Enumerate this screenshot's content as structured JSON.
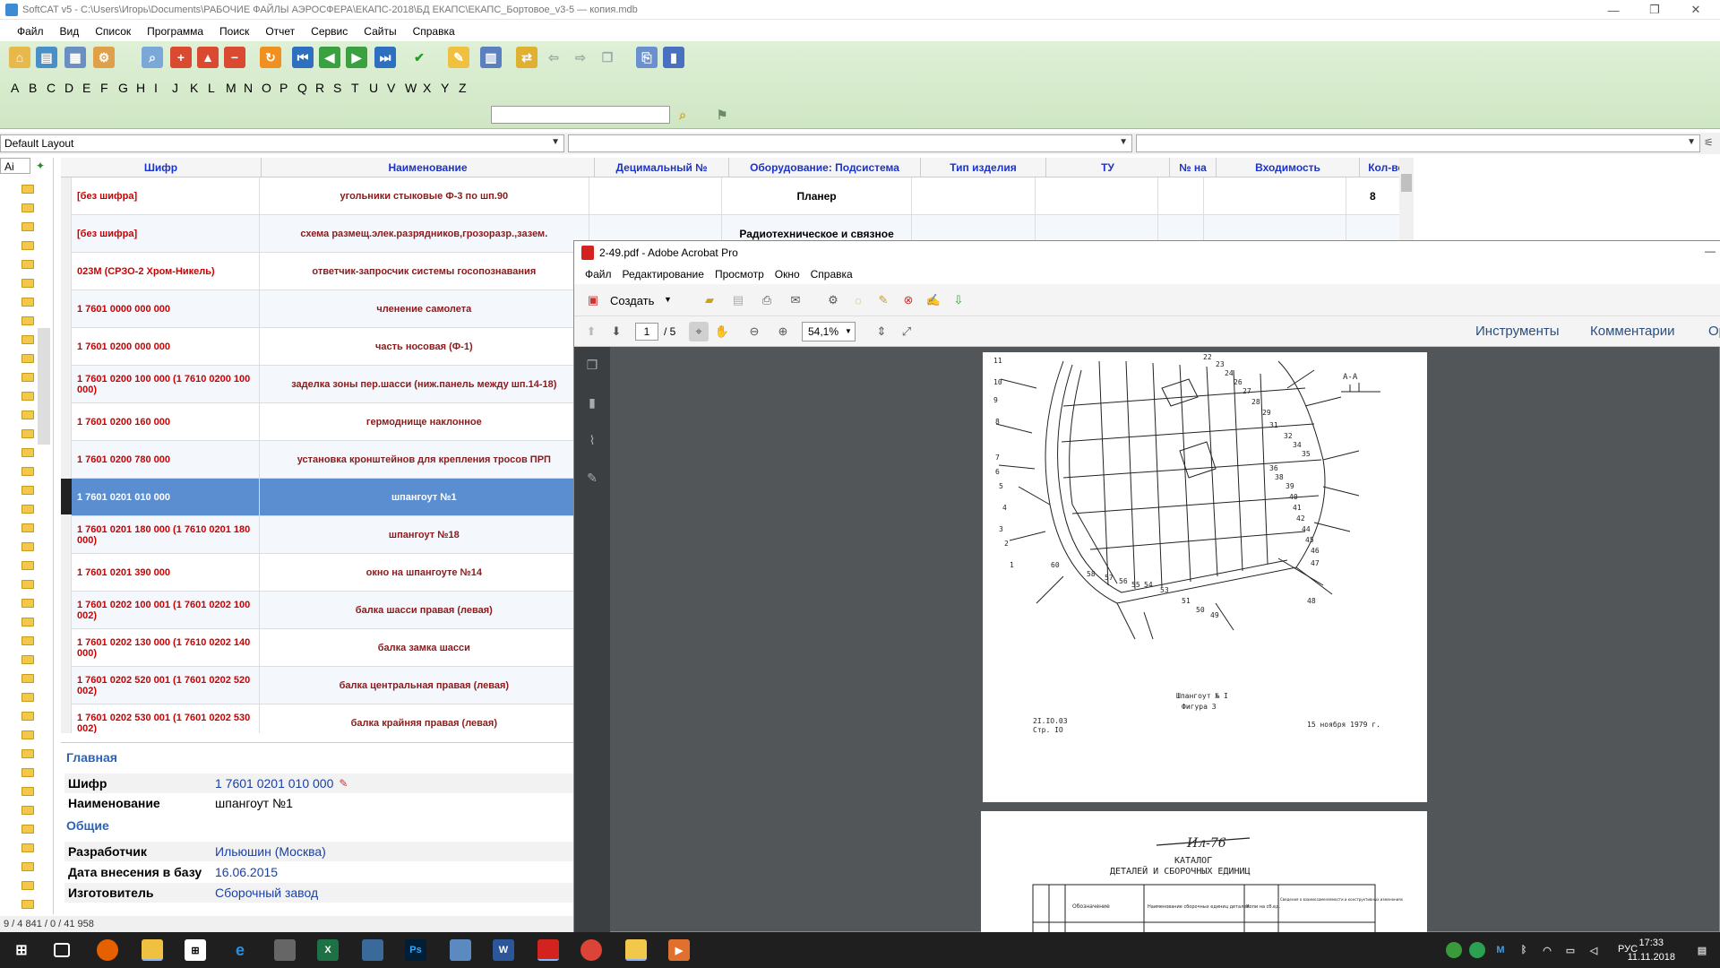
{
  "window": {
    "title": "SoftCAT v5 - C:\\Users\\Игорь\\Documents\\РАБОЧИЕ ФАЙЛЫ АЭРОСФЕРА\\ЕКАПС-2018\\БД ЕКАПС\\ЕКАПС_Бортовое_v3-5 — копия.mdb"
  },
  "menu": [
    "Файл",
    "Вид",
    "Список",
    "Программа",
    "Поиск",
    "Отчет",
    "Сервис",
    "Сайты",
    "Справка"
  ],
  "alphabet": [
    "A",
    "B",
    "C",
    "D",
    "E",
    "F",
    "G",
    "H",
    "I",
    "J",
    "K",
    "L",
    "M",
    "N",
    "O",
    "P",
    "Q",
    "R",
    "S",
    "T",
    "U",
    "V",
    "W",
    "X",
    "Y",
    "Z"
  ],
  "search": {
    "value": "",
    "placeholder": ""
  },
  "layout": {
    "selected": "Default Layout",
    "combo2": "",
    "combo3": ""
  },
  "tree_combo": "Ai",
  "grid": {
    "columns": [
      "Шифр",
      "Наименование",
      "Децимальный №",
      "Оборудование: Подсистема",
      "Тип изделия",
      "ТУ",
      "№ на",
      "Входимость",
      "Кол-во"
    ],
    "rows": [
      {
        "code": "[без шифра]",
        "name": "угольники стыковые Ф-3 по шп.90",
        "system": "Планер",
        "qty": "8"
      },
      {
        "code": "[без шифра]",
        "name": "схема размещ.элек.разрядников,грозоразр.,зазем.",
        "system": "Радиотехническое и связное",
        "qty": ""
      },
      {
        "code": "023М (СРЗО-2 Хром-Никель)",
        "name": "ответчик-запросчик системы госопознавания",
        "system": "",
        "qty": ""
      },
      {
        "code": "1 7601 0000 000 000",
        "name": "членение самолета",
        "system": "",
        "qty": ""
      },
      {
        "code": "1 7601 0200 000 000",
        "name": "часть носовая (Ф-1)",
        "system": "",
        "qty": ""
      },
      {
        "code": "1 7601 0200 100 000 (1 7610 0200 100 000)",
        "name": "заделка зоны пер.шасси (ниж.панель между шп.14-18)",
        "system": "",
        "qty": ""
      },
      {
        "code": "1 7601 0200 160 000",
        "name": "гермоднище наклонное",
        "system": "",
        "qty": ""
      },
      {
        "code": "1 7601 0200 780 000",
        "name": "установка кронштейнов для крепления тросов ПРП",
        "system": "",
        "qty": ""
      },
      {
        "code": "1 7601 0201 010 000",
        "name": "шпангоут №1",
        "system": "",
        "qty": "",
        "selected": true
      },
      {
        "code": "1 7601 0201 180 000 (1 7610 0201 180 000)",
        "name": "шпангоут №18",
        "system": "",
        "qty": ""
      },
      {
        "code": "1 7601 0201 390 000",
        "name": "окно на шпангоуте №14",
        "system": "",
        "qty": ""
      },
      {
        "code": "1 7601 0202 100 001 (1 7601 0202 100 002)",
        "name": "балка шасси правая (левая)",
        "system": "",
        "qty": ""
      },
      {
        "code": "1 7601 0202 130 000 (1 7610 0202 140 000)",
        "name": "балка замка шасси",
        "system": "",
        "qty": ""
      },
      {
        "code": "1 7601 0202 520 001 (1 7601 0202 520 002)",
        "name": "балка центральная правая (левая)",
        "system": "",
        "qty": ""
      },
      {
        "code": "1 7601 0202 530 001 (1 7601 0202 530 002)",
        "name": "балка крайняя правая (левая)",
        "system": "",
        "qty": ""
      }
    ]
  },
  "details": {
    "section_main": "Главная",
    "code_label": "Шифр",
    "code_value": "1 7601 0201 010 000",
    "name_label": "Наименование",
    "name_value": "шпангоут №1",
    "section_general": "Общие",
    "dev_label": "Разработчик",
    "dev_value": "Ильюшин (Москва)",
    "date_label": "Дата внесения в базу",
    "date_value": "16.06.2015",
    "maker_label": "Изготовитель",
    "maker_value": "Сборочный завод"
  },
  "status": "9 / 4 841 / 0 / 41 958",
  "acrobat": {
    "title": "2-49.pdf - Adobe Acrobat Pro",
    "menu": [
      "Файл",
      "Редактирование",
      "Просмотр",
      "Окно",
      "Справка"
    ],
    "create_label": "Создать",
    "page_current": "1",
    "page_total": "/ 5",
    "zoom": "54,1%",
    "tools_label": "Инструменты",
    "comments_label": "Комментарии",
    "share_label": "Ор",
    "page1": {
      "section_label": "А-А",
      "caption1": "Шпангоут № I",
      "caption2": "Фигура 3",
      "ref1": "2I.IO.03",
      "ref2": "Стр. IO",
      "date": "15 ноября 1979 г."
    },
    "page2": {
      "logo": "Ил-76",
      "title1": "КАТАЛОГ",
      "title2": "ДЕТАЛЕЙ И СБОРОЧНЫХ ЕДИНИЦ",
      "col_designation": "Обозначение",
      "col_name": "Наименование сборочных единиц деталей",
      "col_qty": "Копи на сб.ед.",
      "col_info": "Сведения о взаимозаменяемости и конструктивных изменениях"
    }
  },
  "clock": {
    "time": "17:33",
    "date": "11.11.2018"
  },
  "lang": "РУС"
}
